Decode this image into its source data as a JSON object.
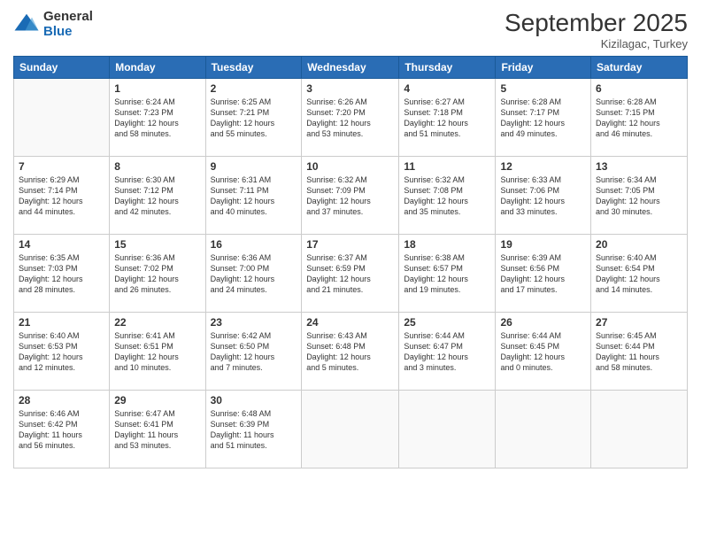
{
  "logo": {
    "general": "General",
    "blue": "Blue"
  },
  "header": {
    "month": "September 2025",
    "location": "Kizilagac, Turkey"
  },
  "columns": [
    "Sunday",
    "Monday",
    "Tuesday",
    "Wednesday",
    "Thursday",
    "Friday",
    "Saturday"
  ],
  "weeks": [
    [
      {
        "day": "",
        "lines": []
      },
      {
        "day": "1",
        "lines": [
          "Sunrise: 6:24 AM",
          "Sunset: 7:23 PM",
          "Daylight: 12 hours",
          "and 58 minutes."
        ]
      },
      {
        "day": "2",
        "lines": [
          "Sunrise: 6:25 AM",
          "Sunset: 7:21 PM",
          "Daylight: 12 hours",
          "and 55 minutes."
        ]
      },
      {
        "day": "3",
        "lines": [
          "Sunrise: 6:26 AM",
          "Sunset: 7:20 PM",
          "Daylight: 12 hours",
          "and 53 minutes."
        ]
      },
      {
        "day": "4",
        "lines": [
          "Sunrise: 6:27 AM",
          "Sunset: 7:18 PM",
          "Daylight: 12 hours",
          "and 51 minutes."
        ]
      },
      {
        "day": "5",
        "lines": [
          "Sunrise: 6:28 AM",
          "Sunset: 7:17 PM",
          "Daylight: 12 hours",
          "and 49 minutes."
        ]
      },
      {
        "day": "6",
        "lines": [
          "Sunrise: 6:28 AM",
          "Sunset: 7:15 PM",
          "Daylight: 12 hours",
          "and 46 minutes."
        ]
      }
    ],
    [
      {
        "day": "7",
        "lines": [
          "Sunrise: 6:29 AM",
          "Sunset: 7:14 PM",
          "Daylight: 12 hours",
          "and 44 minutes."
        ]
      },
      {
        "day": "8",
        "lines": [
          "Sunrise: 6:30 AM",
          "Sunset: 7:12 PM",
          "Daylight: 12 hours",
          "and 42 minutes."
        ]
      },
      {
        "day": "9",
        "lines": [
          "Sunrise: 6:31 AM",
          "Sunset: 7:11 PM",
          "Daylight: 12 hours",
          "and 40 minutes."
        ]
      },
      {
        "day": "10",
        "lines": [
          "Sunrise: 6:32 AM",
          "Sunset: 7:09 PM",
          "Daylight: 12 hours",
          "and 37 minutes."
        ]
      },
      {
        "day": "11",
        "lines": [
          "Sunrise: 6:32 AM",
          "Sunset: 7:08 PM",
          "Daylight: 12 hours",
          "and 35 minutes."
        ]
      },
      {
        "day": "12",
        "lines": [
          "Sunrise: 6:33 AM",
          "Sunset: 7:06 PM",
          "Daylight: 12 hours",
          "and 33 minutes."
        ]
      },
      {
        "day": "13",
        "lines": [
          "Sunrise: 6:34 AM",
          "Sunset: 7:05 PM",
          "Daylight: 12 hours",
          "and 30 minutes."
        ]
      }
    ],
    [
      {
        "day": "14",
        "lines": [
          "Sunrise: 6:35 AM",
          "Sunset: 7:03 PM",
          "Daylight: 12 hours",
          "and 28 minutes."
        ]
      },
      {
        "day": "15",
        "lines": [
          "Sunrise: 6:36 AM",
          "Sunset: 7:02 PM",
          "Daylight: 12 hours",
          "and 26 minutes."
        ]
      },
      {
        "day": "16",
        "lines": [
          "Sunrise: 6:36 AM",
          "Sunset: 7:00 PM",
          "Daylight: 12 hours",
          "and 24 minutes."
        ]
      },
      {
        "day": "17",
        "lines": [
          "Sunrise: 6:37 AM",
          "Sunset: 6:59 PM",
          "Daylight: 12 hours",
          "and 21 minutes."
        ]
      },
      {
        "day": "18",
        "lines": [
          "Sunrise: 6:38 AM",
          "Sunset: 6:57 PM",
          "Daylight: 12 hours",
          "and 19 minutes."
        ]
      },
      {
        "day": "19",
        "lines": [
          "Sunrise: 6:39 AM",
          "Sunset: 6:56 PM",
          "Daylight: 12 hours",
          "and 17 minutes."
        ]
      },
      {
        "day": "20",
        "lines": [
          "Sunrise: 6:40 AM",
          "Sunset: 6:54 PM",
          "Daylight: 12 hours",
          "and 14 minutes."
        ]
      }
    ],
    [
      {
        "day": "21",
        "lines": [
          "Sunrise: 6:40 AM",
          "Sunset: 6:53 PM",
          "Daylight: 12 hours",
          "and 12 minutes."
        ]
      },
      {
        "day": "22",
        "lines": [
          "Sunrise: 6:41 AM",
          "Sunset: 6:51 PM",
          "Daylight: 12 hours",
          "and 10 minutes."
        ]
      },
      {
        "day": "23",
        "lines": [
          "Sunrise: 6:42 AM",
          "Sunset: 6:50 PM",
          "Daylight: 12 hours",
          "and 7 minutes."
        ]
      },
      {
        "day": "24",
        "lines": [
          "Sunrise: 6:43 AM",
          "Sunset: 6:48 PM",
          "Daylight: 12 hours",
          "and 5 minutes."
        ]
      },
      {
        "day": "25",
        "lines": [
          "Sunrise: 6:44 AM",
          "Sunset: 6:47 PM",
          "Daylight: 12 hours",
          "and 3 minutes."
        ]
      },
      {
        "day": "26",
        "lines": [
          "Sunrise: 6:44 AM",
          "Sunset: 6:45 PM",
          "Daylight: 12 hours",
          "and 0 minutes."
        ]
      },
      {
        "day": "27",
        "lines": [
          "Sunrise: 6:45 AM",
          "Sunset: 6:44 PM",
          "Daylight: 11 hours",
          "and 58 minutes."
        ]
      }
    ],
    [
      {
        "day": "28",
        "lines": [
          "Sunrise: 6:46 AM",
          "Sunset: 6:42 PM",
          "Daylight: 11 hours",
          "and 56 minutes."
        ]
      },
      {
        "day": "29",
        "lines": [
          "Sunrise: 6:47 AM",
          "Sunset: 6:41 PM",
          "Daylight: 11 hours",
          "and 53 minutes."
        ]
      },
      {
        "day": "30",
        "lines": [
          "Sunrise: 6:48 AM",
          "Sunset: 6:39 PM",
          "Daylight: 11 hours",
          "and 51 minutes."
        ]
      },
      {
        "day": "",
        "lines": []
      },
      {
        "day": "",
        "lines": []
      },
      {
        "day": "",
        "lines": []
      },
      {
        "day": "",
        "lines": []
      }
    ]
  ]
}
